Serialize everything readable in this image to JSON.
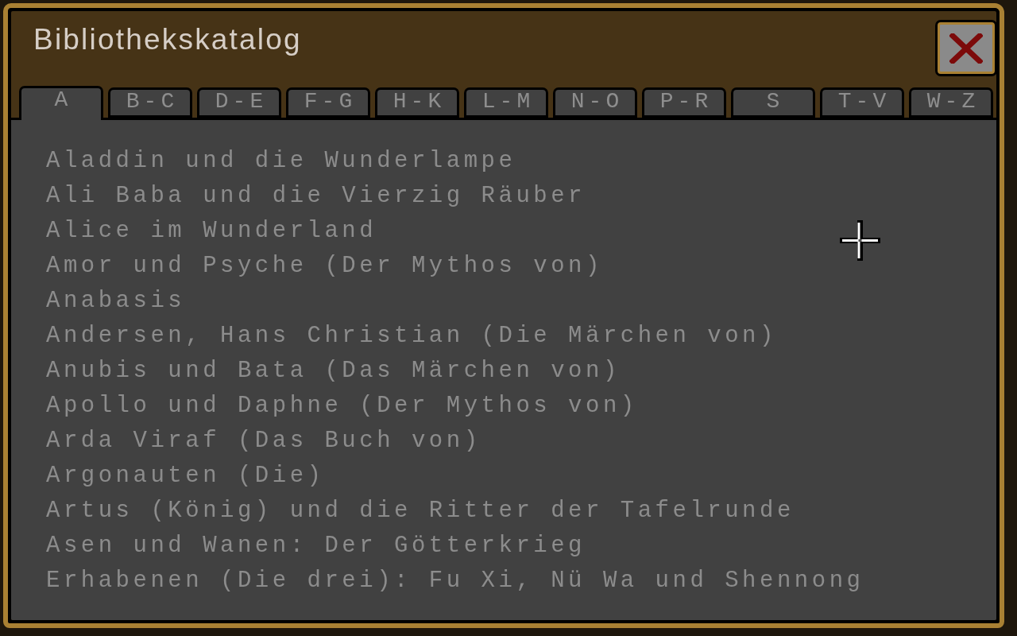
{
  "window": {
    "title": "Bibliothekskatalog"
  },
  "tabs": [
    {
      "label": "A",
      "selected": true
    },
    {
      "label": "B-C",
      "selected": false
    },
    {
      "label": "D-E",
      "selected": false
    },
    {
      "label": "F-G",
      "selected": false
    },
    {
      "label": "H-K",
      "selected": false
    },
    {
      "label": "L-M",
      "selected": false
    },
    {
      "label": "N-O",
      "selected": false
    },
    {
      "label": "P-R",
      "selected": false
    },
    {
      "label": "S",
      "selected": false
    },
    {
      "label": "T-V",
      "selected": false
    },
    {
      "label": "W-Z",
      "selected": false
    }
  ],
  "entries": [
    "Aladdin und die Wunderlampe",
    "Ali Baba und die Vierzig Räuber",
    "Alice im Wunderland",
    "Amor und Psyche (Der Mythos von)",
    "Anabasis",
    "Andersen, Hans Christian (Die Märchen von)",
    "Anubis und Bata (Das Märchen von)",
    "Apollo und Daphne (Der Mythos von)",
    "Arda Viraf (Das Buch von)",
    "Argonauten (Die)",
    "Artus (König) und die Ritter der Tafelrunde",
    "Asen und Wanen: Der Götterkrieg",
    "Erhabenen (Die drei): Fu Xi, Nü Wa und Shennong"
  ]
}
